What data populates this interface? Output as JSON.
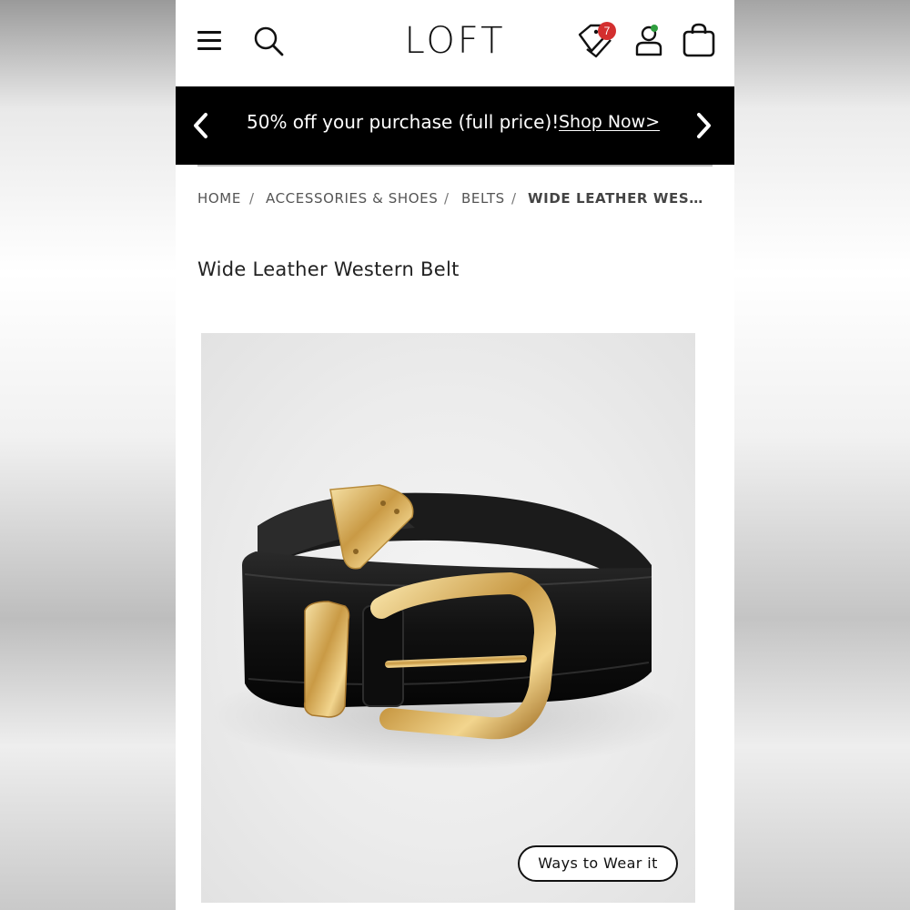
{
  "header": {
    "logo": "LOFT",
    "wishlist_count": "7",
    "icons": [
      "menu-icon",
      "search-icon",
      "tag-icon",
      "account-icon",
      "bag-icon"
    ]
  },
  "promo": {
    "text": "50% off your purchase (full price)!",
    "link": "Shop Now>"
  },
  "breadcrumb": {
    "items": [
      "HOME",
      "ACCESSORIES & SHOES",
      "BELTS"
    ],
    "separator": "/",
    "current": "WIDE LEATHER WESTERN BELT"
  },
  "product": {
    "title": "Wide Leather Western Belt",
    "ways_to_wear": "Ways to Wear it"
  },
  "colors": {
    "promo_bg": "#000000",
    "badge": "#d32f2f",
    "online_dot": "#2e9e3e"
  }
}
